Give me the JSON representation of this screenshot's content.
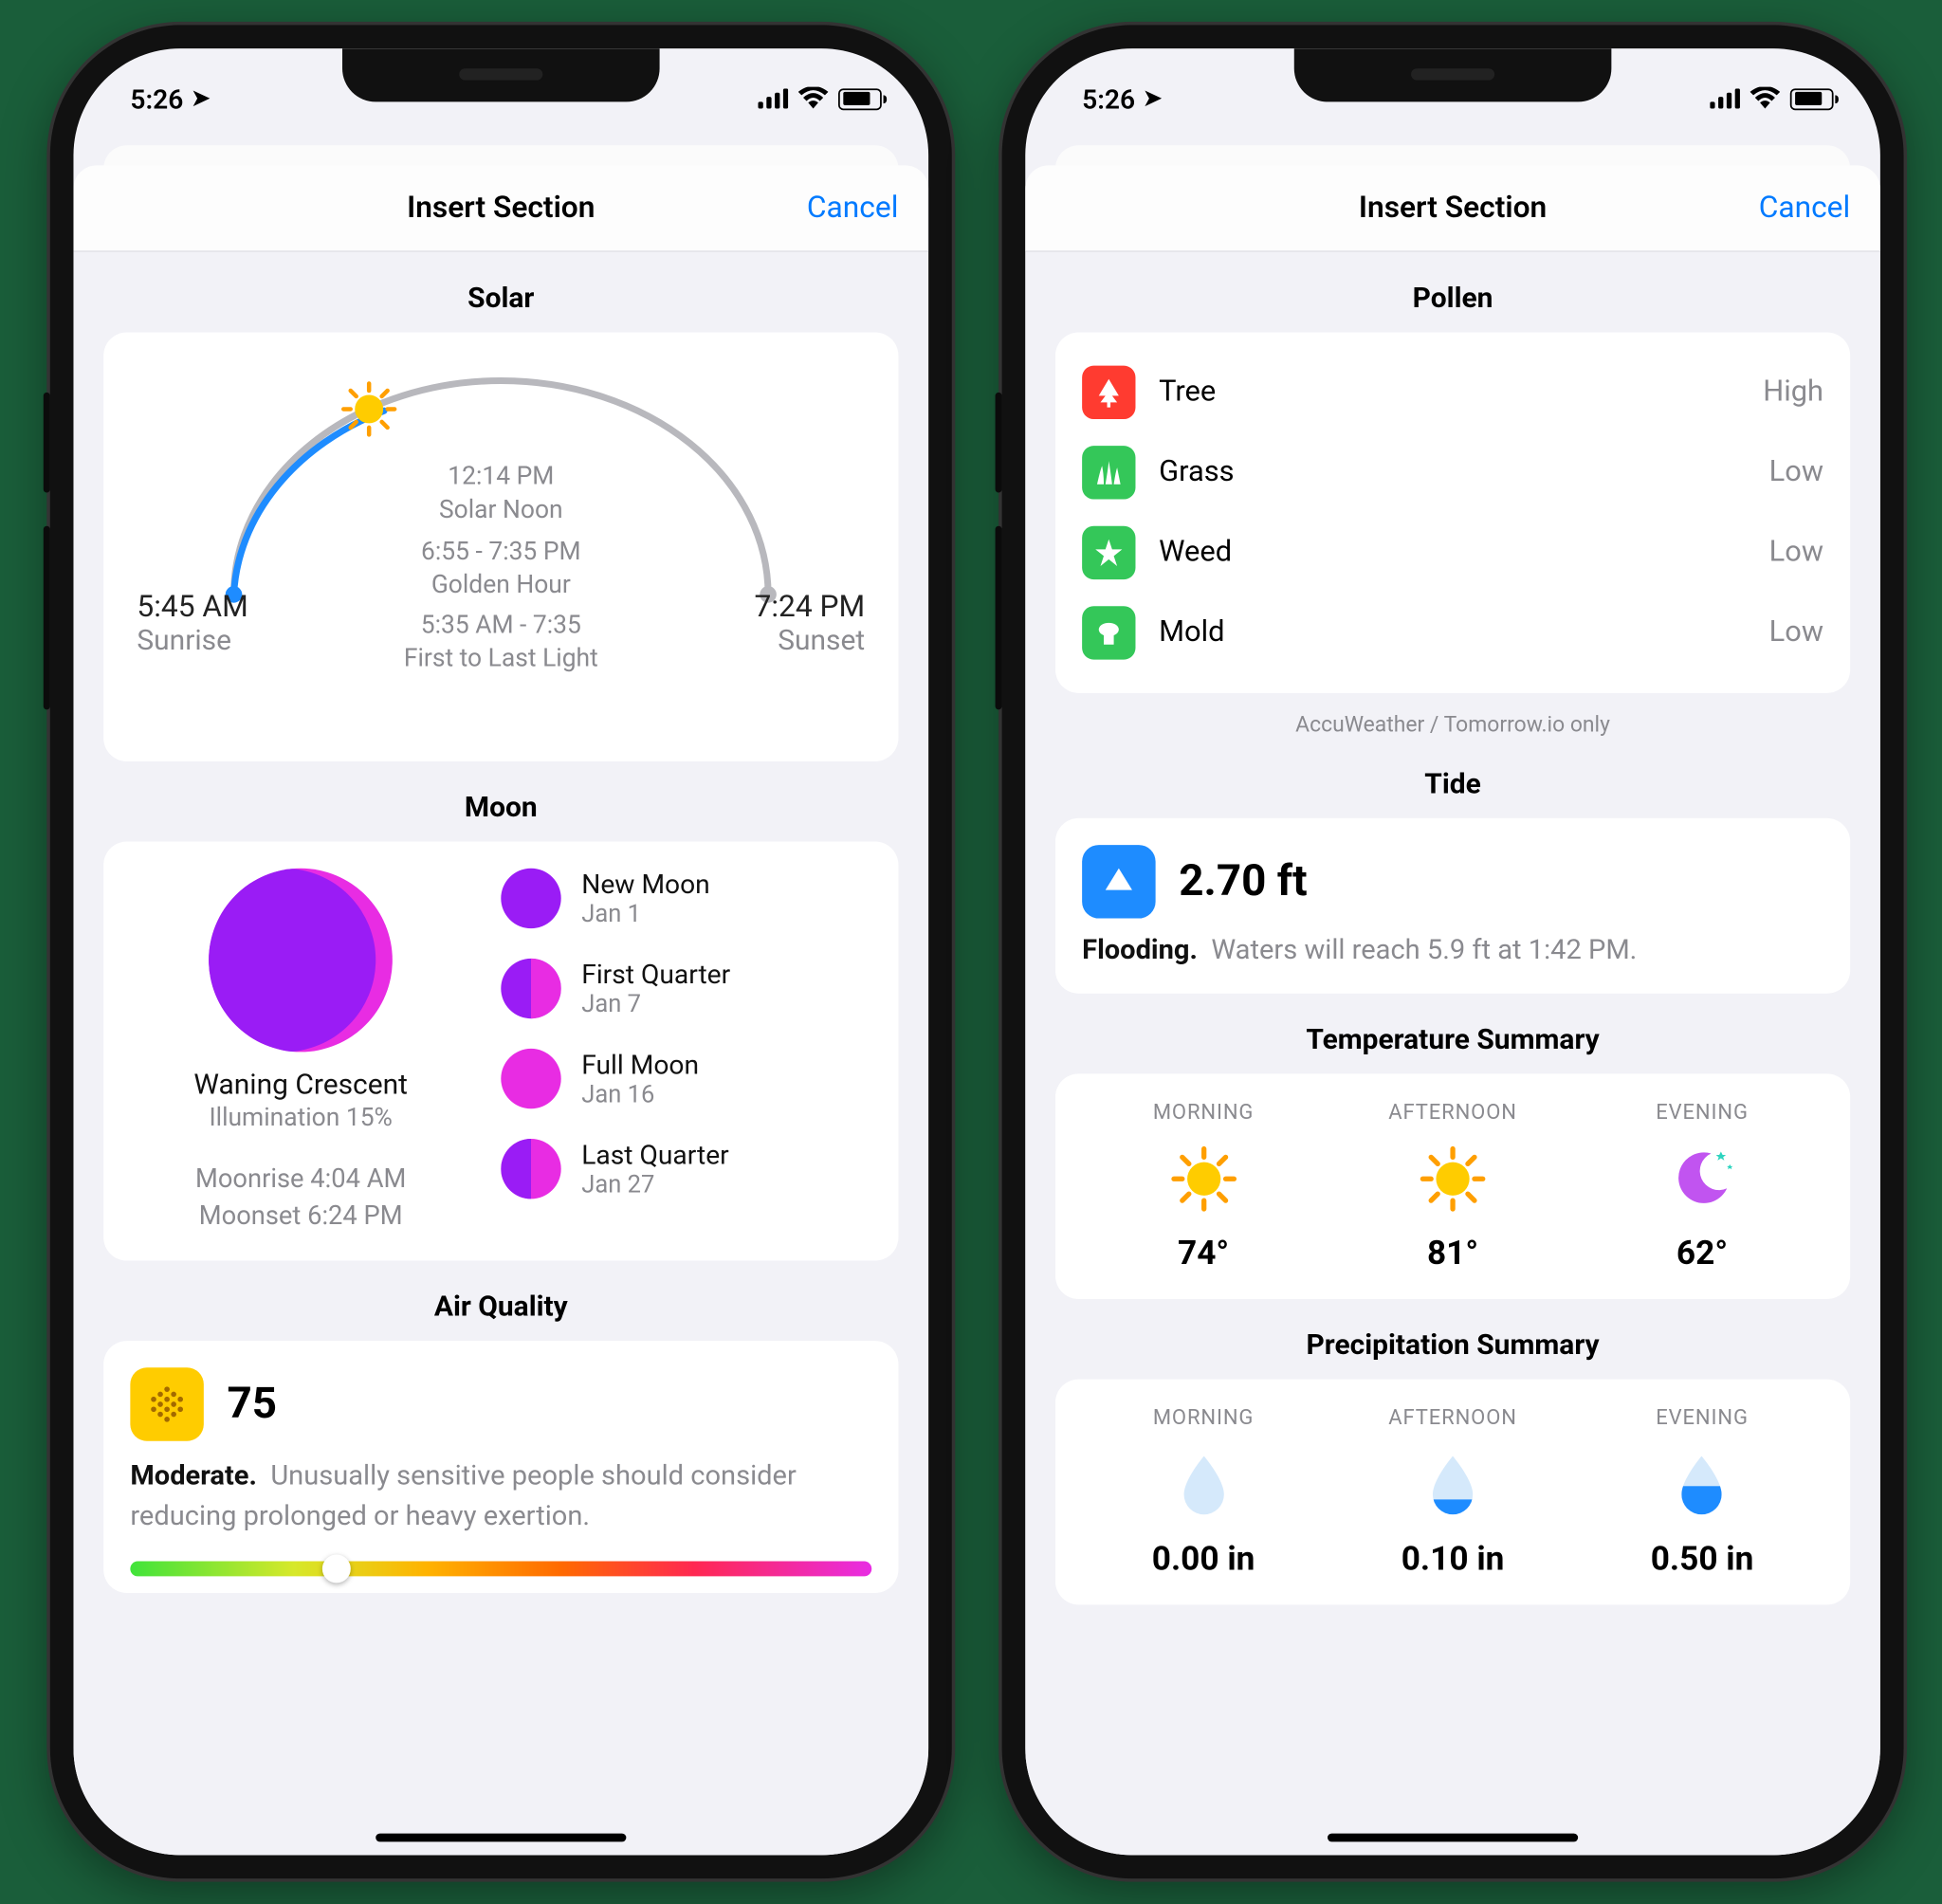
{
  "status": {
    "time": "5:26"
  },
  "sheet": {
    "title": "Insert Section",
    "cancel": "Cancel"
  },
  "left": {
    "solar": {
      "title": "Solar",
      "sunrise_time": "5:45 AM",
      "sunrise_lbl": "Sunrise",
      "sunset_time": "7:24 PM",
      "sunset_lbl": "Sunset",
      "noon_time": "12:14 PM",
      "noon_lbl": "Solar Noon",
      "golden_time": "6:55 - 7:35 PM",
      "golden_lbl": "Golden Hour",
      "light_time": "5:35 AM - 7:35",
      "light_lbl": "First to Last Light"
    },
    "moon": {
      "title": "Moon",
      "phase_name": "Waning Crescent",
      "illum": "Illumination 15%",
      "moonrise": "Moonrise 4:04 AM",
      "moonset": "Moonset 6:24 PM",
      "phases": [
        {
          "name": "New Moon",
          "date": "Jan 1"
        },
        {
          "name": "First Quarter",
          "date": "Jan 7"
        },
        {
          "name": "Full Moon",
          "date": "Jan 16"
        },
        {
          "name": "Last Quarter",
          "date": "Jan 27"
        }
      ]
    },
    "aqi": {
      "title": "Air Quality",
      "value": "75",
      "level": "Moderate.",
      "desc": "Unusually sensitive people should consider reducing prolonged or heavy exertion."
    }
  },
  "right": {
    "pollen": {
      "title": "Pollen",
      "items": [
        {
          "name": "Tree",
          "value": "High"
        },
        {
          "name": "Grass",
          "value": "Low"
        },
        {
          "name": "Weed",
          "value": "Low"
        },
        {
          "name": "Mold",
          "value": "Low"
        }
      ],
      "note": "AccuWeather / Tomorrow.io only"
    },
    "tide": {
      "title": "Tide",
      "value": "2.70 ft",
      "level": "Flooding.",
      "desc": "Waters will reach 5.9 ft at 1:42 PM."
    },
    "temp": {
      "title": "Temperature Summary",
      "cols": [
        {
          "lbl": "MORNING",
          "val": "74°"
        },
        {
          "lbl": "AFTERNOON",
          "val": "81°"
        },
        {
          "lbl": "EVENING",
          "val": "62°"
        }
      ]
    },
    "precip": {
      "title": "Precipitation Summary",
      "cols": [
        {
          "lbl": "MORNING",
          "val": "0.00 in"
        },
        {
          "lbl": "AFTERNOON",
          "val": "0.10 in"
        },
        {
          "lbl": "EVENING",
          "val": "0.50 in"
        }
      ]
    }
  }
}
